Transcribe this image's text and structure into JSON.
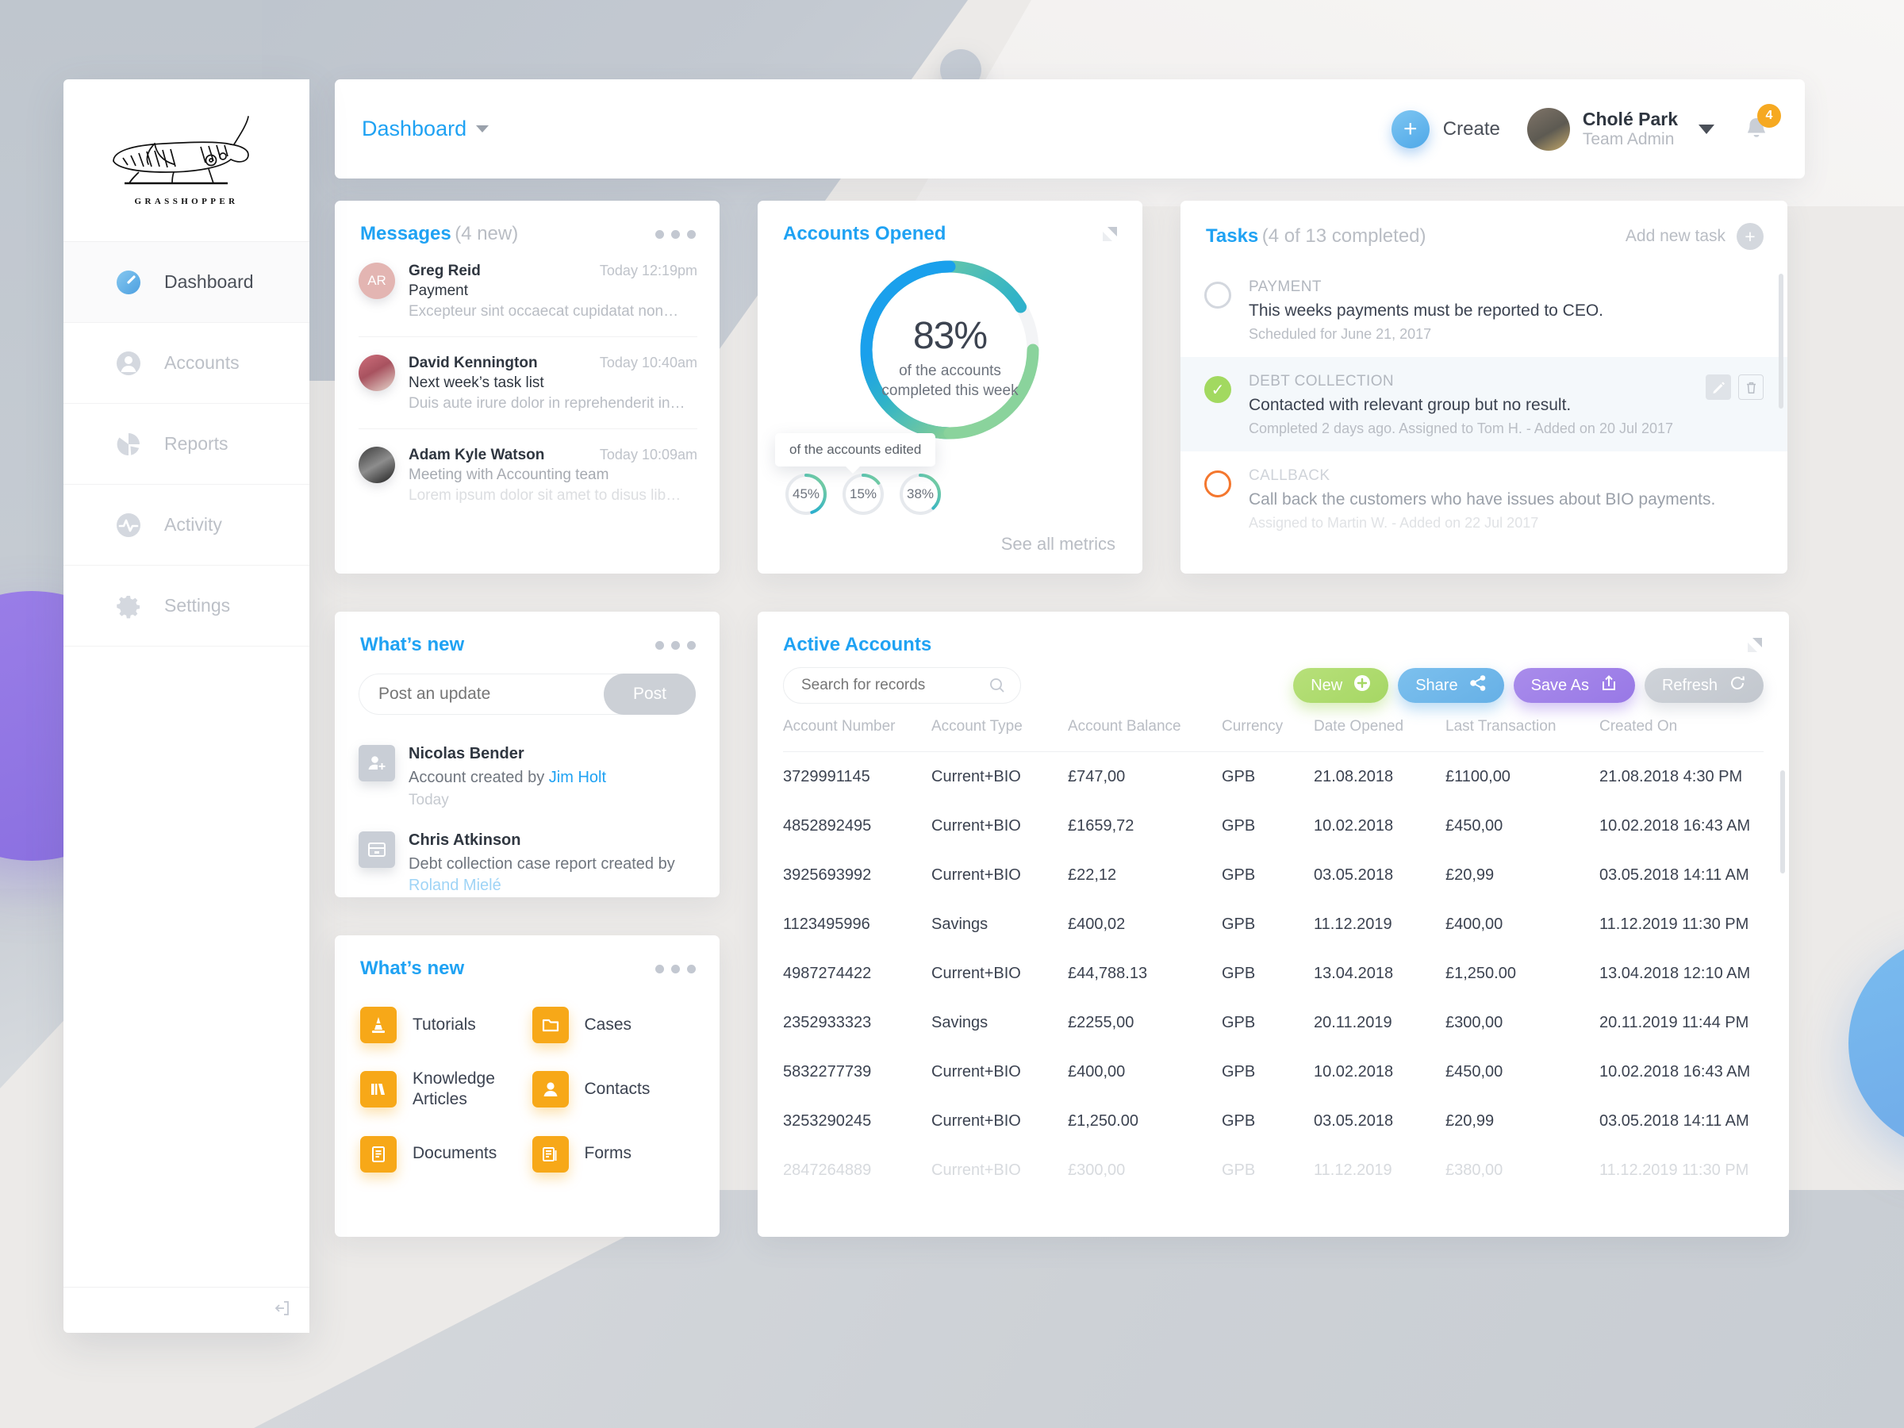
{
  "brand": {
    "name": "GRASSHOPPER",
    "logo_icon": "grasshopper-logo"
  },
  "sidebar": {
    "items": [
      {
        "label": "Dashboard",
        "icon": "dashboard-gauge-icon",
        "active": true
      },
      {
        "label": "Accounts",
        "icon": "user-circle-icon",
        "active": false
      },
      {
        "label": "Reports",
        "icon": "pie-chart-icon",
        "active": false
      },
      {
        "label": "Activity",
        "icon": "activity-pulse-icon",
        "active": false
      },
      {
        "label": "Settings",
        "icon": "gear-icon",
        "active": false
      }
    ],
    "logout_icon": "logout-icon"
  },
  "topbar": {
    "breadcrumb": "Dashboard",
    "breadcrumb_caret_icon": "chevron-down-icon",
    "create_label": "Create",
    "create_icon": "plus-icon",
    "user": {
      "name": "Cholé Park",
      "role": "Team Admin",
      "avatar_icon": "user-avatar"
    },
    "user_caret_icon": "chevron-down-icon",
    "bell_icon": "bell-icon",
    "notification_count": "4"
  },
  "messages": {
    "title": "Messages",
    "subtitle": "(4 new)",
    "menu_icon": "more-horizontal-icon",
    "items": [
      {
        "initials": "AR",
        "avatar_class": "ar",
        "name": "Greg Reid",
        "time": "Today  12:19pm",
        "subject": "Payment",
        "preview": "Excepteur sint occaecat cupidatat non…",
        "faded": false
      },
      {
        "initials": "",
        "avatar_class": "dk",
        "name": "David Kennington",
        "time": "Today  10:40am",
        "subject": "Next week’s task list",
        "preview": "Duis aute irure dolor in reprehenderit in…",
        "faded": false
      },
      {
        "initials": "",
        "avatar_class": "ak",
        "name": "Adam Kyle Watson",
        "time": "Today  10:09am",
        "subject": "Meeting with Accounting team",
        "preview": "Lorem ipsum dolor sit amet to disus lib…",
        "faded": true
      }
    ]
  },
  "accounts_opened": {
    "title": "Accounts Opened",
    "expand_icon": "expand-icon",
    "percent": "83%",
    "caption": "of the accounts completed this week",
    "tooltip": "of the accounts edited",
    "see_all_label": "See all metrics",
    "mini": [
      {
        "label": "45%",
        "value": 45
      },
      {
        "label": "15%",
        "value": 15
      },
      {
        "label": "38%",
        "value": 38
      }
    ]
  },
  "tasks": {
    "title": "Tasks",
    "subtitle": "(4 of 13 completed)",
    "add_label": "Add new task",
    "add_icon": "plus-icon",
    "edit_icon": "pencil-icon",
    "delete_icon": "trash-icon",
    "items": [
      {
        "state": "empty",
        "category": "PAYMENT",
        "text": "This weeks payments must be reported to CEO.",
        "meta": "Scheduled for June 21, 2017",
        "selected": false,
        "faded": false
      },
      {
        "state": "done",
        "category": "DEBT COLLECTION",
        "text": "Contacted with relevant group but no result.",
        "meta": "Completed 2 days ago. Assigned to Tom H. - Added on 20 Jul 2017",
        "selected": true,
        "faded": false
      },
      {
        "state": "orange",
        "category": "CALLBACK",
        "text": "Call back the customers who have issues about BIO payments.",
        "meta": "Assigned to Martin W. - Added on 22 Jul 2017",
        "selected": false,
        "faded": true
      }
    ]
  },
  "whats_new_feed": {
    "title": "What’s new",
    "menu_icon": "more-horizontal-icon",
    "post_placeholder": "Post an update",
    "post_button": "Post",
    "items": [
      {
        "icon": "add-user-icon",
        "name": "Nicolas Bender",
        "text_before": "Account created by ",
        "link": "Jim Holt",
        "link_pale": false,
        "time": "Today"
      },
      {
        "icon": "archive-box-icon",
        "name": "Chris Atkinson",
        "text_before": "Debt collection case report created by ",
        "link": "Roland Mielé",
        "link_pale": true,
        "time": ""
      }
    ]
  },
  "whats_new_tiles": {
    "title": "What’s new",
    "menu_icon": "more-horizontal-icon",
    "tiles": [
      {
        "label": "Tutorials",
        "icon": "traffic-cone-icon"
      },
      {
        "label": "Cases",
        "icon": "folder-icon"
      },
      {
        "label": "Knowledge Articles",
        "icon": "books-icon"
      },
      {
        "label": "Contacts",
        "icon": "contact-person-icon"
      },
      {
        "label": "Documents",
        "icon": "document-list-icon"
      },
      {
        "label": "Forms",
        "icon": "forms-icon"
      }
    ]
  },
  "active_accounts": {
    "title": "Active Accounts",
    "expand_icon": "expand-icon",
    "search_placeholder": "Search for records",
    "search_icon": "search-icon",
    "buttons": [
      {
        "label": "New",
        "icon": "plus-circle-icon",
        "class": "new",
        "color": "#a6d764"
      },
      {
        "label": "Share",
        "icon": "share-icon",
        "class": "share",
        "color": "#66b0e6"
      },
      {
        "label": "Save As",
        "icon": "upload-icon",
        "class": "save",
        "color": "#9878e6"
      },
      {
        "label": "Refresh",
        "icon": "refresh-icon",
        "class": "refresh",
        "color": "#c2c7ce"
      }
    ],
    "columns": [
      "Account Number",
      "Account Type",
      "Account Balance",
      "Currency",
      "Date Opened",
      "Last Transaction",
      "Created On"
    ],
    "rows": [
      {
        "cells": [
          "3729991145",
          "Current+BIO",
          "£747,00",
          "GPB",
          "21.08.2018",
          "£1100,00",
          "21.08.2018  4:30 PM"
        ],
        "faded": false
      },
      {
        "cells": [
          "4852892495",
          "Current+BIO",
          "£1659,72",
          "GPB",
          "10.02.2018",
          "£450,00",
          "10.02.2018  16:43 AM"
        ],
        "faded": false
      },
      {
        "cells": [
          "3925693992",
          "Current+BIO",
          "£22,12",
          "GPB",
          "03.05.2018",
          "£20,99",
          "03.05.2018  14:11 AM"
        ],
        "faded": false
      },
      {
        "cells": [
          "1123495996",
          "Savings",
          "£400,02",
          "GPB",
          "11.12.2019",
          "£400,00",
          "11.12.2019  11:30 PM"
        ],
        "faded": false
      },
      {
        "cells": [
          "4987274422",
          "Current+BIO",
          "£44,788.13",
          "GPB",
          "13.04.2018",
          "£1,250.00",
          "13.04.2018  12:10 AM"
        ],
        "faded": false
      },
      {
        "cells": [
          "2352933323",
          "Savings",
          "£2255,00",
          "GPB",
          "20.11.2019",
          "£300,00",
          "20.11.2019  11:44 PM"
        ],
        "faded": false
      },
      {
        "cells": [
          "5832277739",
          "Current+BIO",
          "£400,00",
          "GPB",
          "10.02.2018",
          "£450,00",
          "10.02.2018  16:43 AM"
        ],
        "faded": false
      },
      {
        "cells": [
          "3253290245",
          "Current+BIO",
          "£1,250.00",
          "GPB",
          "03.05.2018",
          "£20,99",
          "03.05.2018  14:11 AM"
        ],
        "faded": false
      },
      {
        "cells": [
          "2847264889",
          "Current+BIO",
          "£300,00",
          "GPB",
          "11.12.2019",
          "£380,00",
          "11.12.2019  11:30 PM"
        ],
        "faded": true
      }
    ]
  },
  "chart_data": {
    "type": "pie",
    "title": "Accounts Opened",
    "main_donut": {
      "label": "83%",
      "value": 83,
      "max": 100,
      "caption": "of the accounts completed this week"
    },
    "mini_donuts": [
      {
        "label": "45%",
        "value": 45,
        "max": 100
      },
      {
        "label": "15%",
        "value": 15,
        "max": 100
      },
      {
        "label": "38%",
        "value": 38,
        "max": 100
      }
    ],
    "colors": {
      "arc_start": "#1aa0ec",
      "arc_mid": "#2fb6c9",
      "arc_end": "#7fd09a",
      "track": "#eceef1"
    },
    "legend": "none"
  },
  "theme": {
    "accent": "#1fa2f3",
    "green": "#a2d960",
    "orange": "#f4772e",
    "amber": "#f7a818",
    "purple": "#9878e6"
  }
}
